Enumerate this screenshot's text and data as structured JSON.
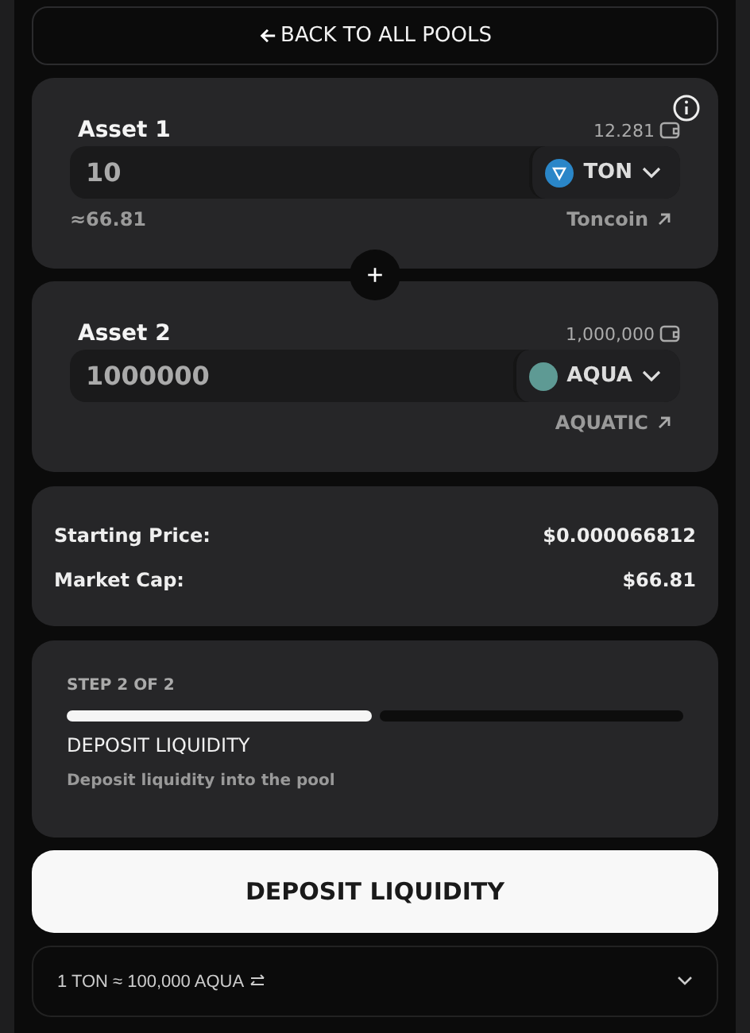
{
  "back_link": {
    "label": "BACK TO ALL POOLS"
  },
  "assets": [
    {
      "label": "Asset 1",
      "balance": "12.281",
      "amount": "10",
      "token": "TON",
      "color": "#2a86c8",
      "usd_value": "≈66.81",
      "token_name": "Toncoin",
      "info": true
    },
    {
      "label": "Asset 2",
      "balance": "1,000,000",
      "amount": "1000000",
      "token": "AQUA",
      "color": "#5e9a94",
      "token_name": "AQUATIC",
      "info": false
    }
  ],
  "add_symbol": "+",
  "summary": [
    {
      "label": "Starting Price:",
      "value": "$0.000066812"
    },
    {
      "label": "Market Cap:",
      "value": "$66.81"
    }
  ],
  "step": {
    "caption": "STEP 2 OF 2",
    "segments": [
      {
        "filled": true
      },
      {
        "filled": false
      }
    ],
    "title": "DEPOSIT LIQUIDITY",
    "description": "Deposit liquidity into the pool"
  },
  "deposit_button": "DEPOSIT LIQUIDITY",
  "rate": {
    "text": "1 TON ≈ 100,000 AQUA",
    "expanded": false
  }
}
